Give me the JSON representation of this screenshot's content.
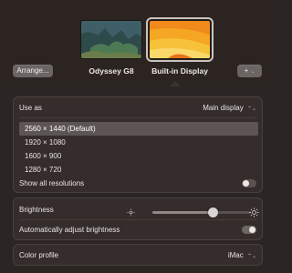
{
  "header": {
    "arrange_label": "Arrange...",
    "displays": [
      {
        "name": "Odyssey G8",
        "selected": false
      },
      {
        "name": "Built-in Display",
        "selected": true
      }
    ],
    "add_label": "+",
    "add_chevron": "⌄"
  },
  "use_as": {
    "label": "Use as",
    "value": "Main display",
    "chevron": "⌃⌄"
  },
  "resolutions": {
    "items": [
      "2560 × 1440 (Default)",
      "1920 × 1080",
      "1600 × 900",
      "1280 × 720"
    ],
    "selected_index": 0,
    "show_all_label": "Show all resolutions",
    "show_all_enabled": false
  },
  "brightness": {
    "label": "Brightness",
    "level": 0.62,
    "auto_label": "Automatically adjust brightness",
    "auto_enabled": true
  },
  "color_profile": {
    "label": "Color profile",
    "value": "iMac",
    "chevron": "⌃⌄"
  },
  "colors": {
    "background": "#2b2523",
    "panel": "#352d2b",
    "selected_row": "#5d5553"
  }
}
